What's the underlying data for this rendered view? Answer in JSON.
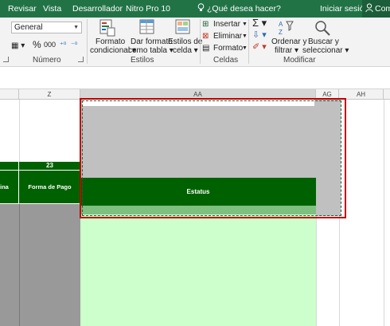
{
  "tabs": [
    "Revisar",
    "Vista",
    "Desarrollador",
    "Nitro Pro 10"
  ],
  "search": {
    "placeholder": "¿Qué desea hacer?"
  },
  "account": {
    "signin": "Iniciar sesión",
    "share_label": "Com"
  },
  "ribbon": {
    "number": {
      "format_value": "General",
      "percent_symbol": "%",
      "thousands_symbol": "000",
      "group_label": "Número"
    },
    "styles": {
      "conditional_format": [
        "Formato",
        "condicional ▾"
      ],
      "format_as_table": [
        "Dar formato",
        "como tabla ▾"
      ],
      "cell_styles": [
        "Estilos de",
        "celda ▾"
      ],
      "group_label": "Estilos"
    },
    "cells": {
      "insert": "Insertar",
      "delete": "Eliminar",
      "format": "Formato",
      "group_label": "Celdas"
    },
    "editing": {
      "sort_filter": [
        "Ordenar y",
        "filtrar ▾"
      ],
      "find_select": [
        "Buscar y",
        "seleccionar ▾"
      ],
      "group_label": "Modificar"
    }
  },
  "columns": [
    "Z",
    "AA",
    "AG",
    "AH"
  ],
  "table": {
    "col_number": "23",
    "left_partial_header": "ina",
    "payment_header": "Forma de Pago",
    "status_header": "Estatus"
  },
  "colors": {
    "ribbon_green": "#217346",
    "header_green": "#006100",
    "body_light_green": "#ccffcc",
    "selection_red": "#c00000",
    "image_gray": "#c0c0c0"
  }
}
